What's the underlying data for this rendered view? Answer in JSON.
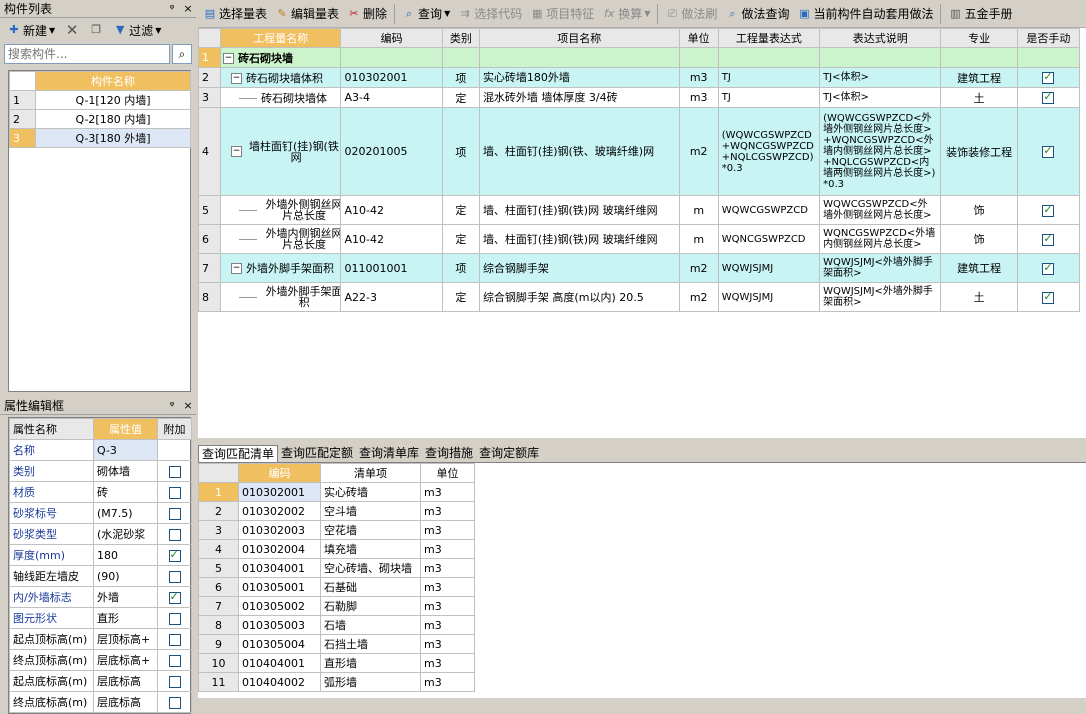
{
  "left_panel": {
    "title": "构件列表",
    "pin": "ᵠ",
    "close": "×",
    "toolbar": {
      "new_label": "新建",
      "filter_label": "过滤"
    },
    "search_placeholder": "搜索构件...",
    "list_header": "构件名称",
    "items": [
      {
        "n": "1",
        "name": "Q-1[120 内墙]"
      },
      {
        "n": "2",
        "name": "Q-2[180 内墙]"
      },
      {
        "n": "3",
        "name": "Q-3[180 外墙]"
      }
    ]
  },
  "prop_panel": {
    "title": "属性编辑框",
    "pin": "ᵠ",
    "close": "×",
    "headers": [
      "属性名称",
      "属性值",
      "附加"
    ],
    "rows": [
      {
        "name": "名称",
        "value": "Q-3",
        "chk": "none",
        "blue": true
      },
      {
        "name": "类别",
        "value": "砌体墙",
        "chk": "off",
        "blue": true
      },
      {
        "name": "材质",
        "value": "砖",
        "chk": "off",
        "blue": true
      },
      {
        "name": "砂浆标号",
        "value": "(M7.5)",
        "chk": "off",
        "blue": true
      },
      {
        "name": "砂浆类型",
        "value": "(水泥砂浆",
        "chk": "off",
        "blue": true
      },
      {
        "name": "厚度(mm)",
        "value": "180",
        "chk": "on",
        "blue": true
      },
      {
        "name": "轴线距左墙皮",
        "value": "(90)",
        "chk": "off",
        "blue": false
      },
      {
        "name": "内/外墙标志",
        "value": "外墙",
        "chk": "on",
        "blue": true
      },
      {
        "name": "图元形状",
        "value": "直形",
        "chk": "off",
        "blue": true
      },
      {
        "name": "起点顶标高(m)",
        "value": "层顶标高+",
        "chk": "off",
        "blue": false
      },
      {
        "name": "终点顶标高(m)",
        "value": "层底标高+",
        "chk": "off",
        "blue": false
      },
      {
        "name": "起点底标高(m)",
        "value": "层底标高",
        "chk": "off",
        "blue": false
      },
      {
        "name": "终点底标高(m)",
        "value": "层底标高",
        "chk": "off",
        "blue": false
      }
    ]
  },
  "main_toolbar": {
    "b1": "选择量表",
    "b2": "编辑量表",
    "b3": "删除",
    "b4": "查询",
    "b5": "选择代码",
    "b6": "项目特征",
    "b7": "换算",
    "b8": "做法刷",
    "b9": "做法查询",
    "b10": "当前构件自动套用做法",
    "b11": "五金手册"
  },
  "quantity_table": {
    "headers": [
      "工程量名称",
      "编码",
      "类别",
      "项目名称",
      "单位",
      "工程量表达式",
      "表达式说明",
      "专业",
      "是否手动"
    ],
    "rows": [
      {
        "n": "1",
        "name": "砖石砌块墙",
        "code": "",
        "type": "",
        "item": "",
        "unit": "",
        "expr": "",
        "desc": "",
        "spec": "",
        "manual": "",
        "style": "grp",
        "box": "−",
        "indent": 0
      },
      {
        "n": "2",
        "name": "砖石砌块墙体积",
        "code": "010302001",
        "type": "项",
        "item": "实心砖墙180外墙",
        "unit": "m3",
        "expr": "TJ",
        "desc": "TJ<体积>",
        "spec": "建筑工程",
        "manual": "on",
        "style": "hl",
        "box": "−",
        "indent": 1
      },
      {
        "n": "3",
        "name": "砖石砌块墙体",
        "code": "A3-4",
        "type": "定",
        "item": "混水砖外墙 墙体厚度 3/4砖",
        "unit": "m3",
        "expr": "TJ",
        "desc": "TJ<体积>",
        "spec": "土",
        "manual": "on",
        "style": "",
        "box": "",
        "indent": 2
      },
      {
        "n": "4",
        "name": "墙柱面钉(挂)钢(铁)网",
        "code": "020201005",
        "type": "项",
        "item": "墙、柱面钉(挂)钢(铁、玻璃纤维)网",
        "unit": "m2",
        "expr": "(WQWCGSWPZCD+WQNCGSWPZCD+NQLCGSWPZCD)*0.3",
        "desc": "(WQWCGSWPZCD<外墙外侧钢丝网片总长度>+WQNCGSWPZCD<外墙内侧钢丝网片总长度>+NQLCGSWPZCD<内墙两侧钢丝网片总长度>)*0.3",
        "spec": "装饰装修工程",
        "manual": "on",
        "style": "hl",
        "box": "−",
        "indent": 1
      },
      {
        "n": "5",
        "name": "外墙外侧钢丝网片总长度",
        "code": "A10-42",
        "type": "定",
        "item": "墙、柱面钉(挂)钢(铁)网 玻璃纤维网",
        "unit": "m",
        "expr": "WQWCGSWPZCD",
        "desc": "WQWCGSWPZCD<外墙外侧钢丝网片总长度>",
        "spec": "饰",
        "manual": "on",
        "style": "",
        "box": "",
        "indent": 2
      },
      {
        "n": "6",
        "name": "外墙内侧钢丝网片总长度",
        "code": "A10-42",
        "type": "定",
        "item": "墙、柱面钉(挂)钢(铁)网 玻璃纤维网",
        "unit": "m",
        "expr": "WQNCGSWPZCD",
        "desc": "WQNCGSWPZCD<外墙内侧钢丝网片总长度>",
        "spec": "饰",
        "manual": "on",
        "style": "",
        "box": "",
        "indent": 2
      },
      {
        "n": "7",
        "name": "外墙外脚手架面积",
        "code": "011001001",
        "type": "项",
        "item": "综合钢脚手架",
        "unit": "m2",
        "expr": "WQWJSJMJ",
        "desc": "WQWJSJMJ<外墙外脚手架面积>",
        "spec": "建筑工程",
        "manual": "on",
        "style": "hl",
        "box": "−",
        "indent": 1
      },
      {
        "n": "8",
        "name": "外墙外脚手架面积",
        "code": "A22-3",
        "type": "定",
        "item": "综合钢脚手架 高度(m以内) 20.5",
        "unit": "m2",
        "expr": "WQWJSJMJ",
        "desc": "WQWJSJMJ<外墙外脚手架面积>",
        "spec": "土",
        "manual": "on",
        "style": "",
        "box": "",
        "indent": 2
      }
    ]
  },
  "tabs": [
    "查询匹配清单",
    "查询匹配定额",
    "查询清单库",
    "查询措施",
    "查询定额库"
  ],
  "match_table": {
    "headers": [
      "编码",
      "清单项",
      "单位"
    ],
    "rows": [
      {
        "n": "1",
        "code": "010302001",
        "item": "实心砖墙",
        "unit": "m3"
      },
      {
        "n": "2",
        "code": "010302002",
        "item": "空斗墙",
        "unit": "m3"
      },
      {
        "n": "3",
        "code": "010302003",
        "item": "空花墙",
        "unit": "m3"
      },
      {
        "n": "4",
        "code": "010302004",
        "item": "填充墙",
        "unit": "m3"
      },
      {
        "n": "5",
        "code": "010304001",
        "item": "空心砖墙、砌块墙",
        "unit": "m3"
      },
      {
        "n": "6",
        "code": "010305001",
        "item": "石基础",
        "unit": "m3"
      },
      {
        "n": "7",
        "code": "010305002",
        "item": "石勒脚",
        "unit": "m3"
      },
      {
        "n": "8",
        "code": "010305003",
        "item": "石墙",
        "unit": "m3"
      },
      {
        "n": "9",
        "code": "010305004",
        "item": "石挡土墙",
        "unit": "m3"
      },
      {
        "n": "10",
        "code": "010404001",
        "item": "直形墙",
        "unit": "m3"
      },
      {
        "n": "11",
        "code": "010404002",
        "item": "弧形墙",
        "unit": "m3"
      }
    ]
  }
}
